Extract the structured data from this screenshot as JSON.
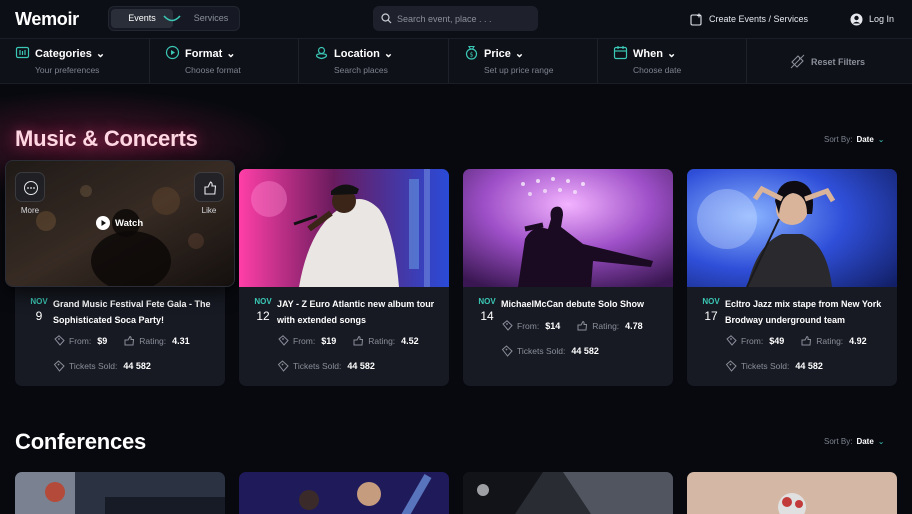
{
  "app": {
    "logo": "Wemoir"
  },
  "nav": {
    "tabs": [
      "Events",
      "Services"
    ],
    "search_placeholder": "Search event, place . . .",
    "create_label": "Create Events / Services",
    "login_label": "Log In"
  },
  "filters": [
    {
      "title": "Categories",
      "subtitle": "Your preferences",
      "icon": "categories-icon"
    },
    {
      "title": "Format",
      "subtitle": "Choose format",
      "icon": "format-icon"
    },
    {
      "title": "Location",
      "subtitle": "Search places",
      "icon": "location-icon"
    },
    {
      "title": "Price",
      "subtitle": "Set up price range",
      "icon": "price-icon"
    },
    {
      "title": "When",
      "subtitle": "Choose date",
      "icon": "calendar-icon"
    }
  ],
  "reset_label": "Reset Filters",
  "sections": [
    {
      "title": "Music & Concerts",
      "sort_label": "Sort By:",
      "sort_value": "Date"
    },
    {
      "title": "Conferences",
      "sort_label": "Sort By:",
      "sort_value": "Date"
    }
  ],
  "featured_overlay": {
    "more": "More",
    "like": "Like",
    "watch": "Watch"
  },
  "labels": {
    "from": "From:",
    "rating": "Rating:",
    "tickets": "Tickets Sold:"
  },
  "events": [
    {
      "month": "NOV",
      "day": "9",
      "title": "Grand Music Festival Fete Gala - The Sophisticated Soca Party!",
      "price": "$9",
      "rating": "4.31",
      "tickets": "44 582"
    },
    {
      "month": "NOV",
      "day": "12",
      "title": "JAY - Z Euro Atlantic new album tour with extended songs",
      "price": "$19",
      "rating": "4.52",
      "tickets": "44 582"
    },
    {
      "month": "NOV",
      "day": "14",
      "title": "MichaelMcCan debute Solo Show",
      "price": "$14",
      "rating": "4.78",
      "tickets": "44 582"
    },
    {
      "month": "NOV",
      "day": "17",
      "title": "Ecltro Jazz mix stape from New York Brodway underground team",
      "price": "$49",
      "rating": "4.92",
      "tickets": "44 582"
    }
  ],
  "colors": {
    "accent": "#3bc7b5",
    "background": "#08090f",
    "card": "#171a23"
  }
}
